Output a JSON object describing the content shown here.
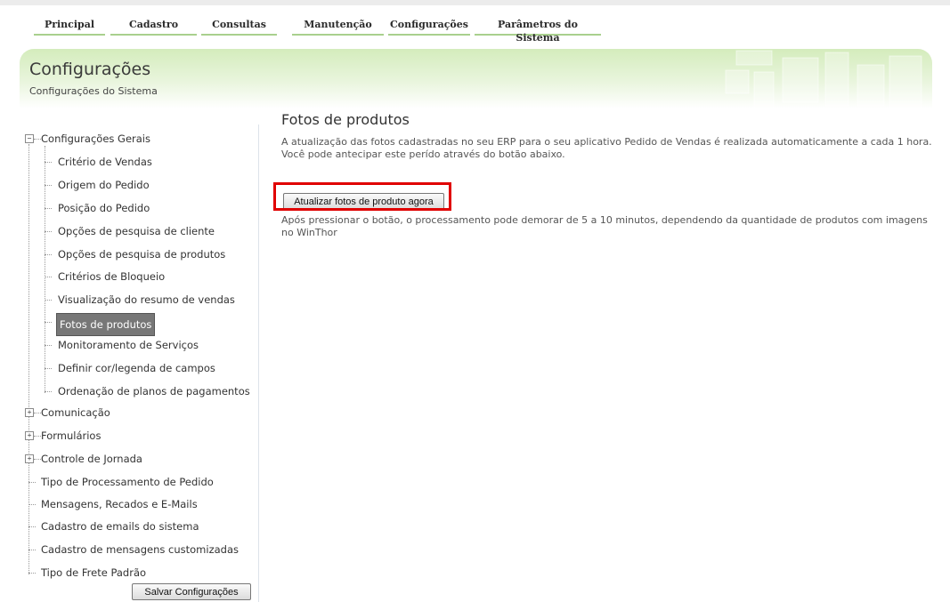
{
  "menu": {
    "items": [
      {
        "label": "Principal"
      },
      {
        "label": "Cadastro"
      },
      {
        "label": "Consultas"
      },
      {
        "label": "Manutenção"
      },
      {
        "label": "Configurações"
      },
      {
        "label": "Parâmetros do Sistema"
      }
    ]
  },
  "banner": {
    "title": "Configurações",
    "subtitle": "Configurações do Sistema"
  },
  "sidebar": {
    "groups": [
      {
        "label": "Configurações Gerais",
        "expanded": true,
        "children": [
          {
            "label": "Critério de Vendas"
          },
          {
            "label": "Origem do Pedido"
          },
          {
            "label": "Posição do Pedido"
          },
          {
            "label": "Opções de pesquisa de cliente"
          },
          {
            "label": "Opções de pesquisa de produtos"
          },
          {
            "label": "Critérios de Bloqueio"
          },
          {
            "label": "Visualização do resumo de vendas"
          },
          {
            "label": "Fotos de produtos",
            "selected": true
          },
          {
            "label": "Monitoramento de Serviços"
          },
          {
            "label": "Definir cor/legenda de campos"
          },
          {
            "label": "Ordenação de planos de pagamentos"
          }
        ]
      },
      {
        "label": "Comunicação",
        "expanded": false
      },
      {
        "label": "Formulários",
        "expanded": false
      },
      {
        "label": "Controle de Jornada",
        "expanded": false
      }
    ],
    "leaves": [
      {
        "label": "Tipo de Processamento de Pedido"
      },
      {
        "label": "Mensagens, Recados e E-Mails"
      },
      {
        "label": "Cadastro de emails do sistema"
      },
      {
        "label": "Cadastro de mensagens customizadas"
      },
      {
        "label": "Tipo de Frete Padrão"
      }
    ],
    "save_label": "Salvar Configurações"
  },
  "content": {
    "title": "Fotos de produtos",
    "description_line1": "A atualização das fotos cadastradas no seu ERP para o seu aplicativo Pedido de Vendas é realizada automaticamente a cada 1 hora.",
    "description_line2": "Você pode antecipar este perído através do botão abaixo.",
    "update_button_label": "Atualizar fotos de produto agora",
    "note_line1": "Após pressionar o botão, o processamento pode demorar de 5 a 10 minutos, dependendo da quantidade de produtos com imagens",
    "note_line2": "no WinThor"
  },
  "colors": {
    "menu_underline": "#a9d08e",
    "banner_green": "#d4ecbc",
    "selected_bg": "#777777",
    "highlight_red": "#e00000"
  }
}
